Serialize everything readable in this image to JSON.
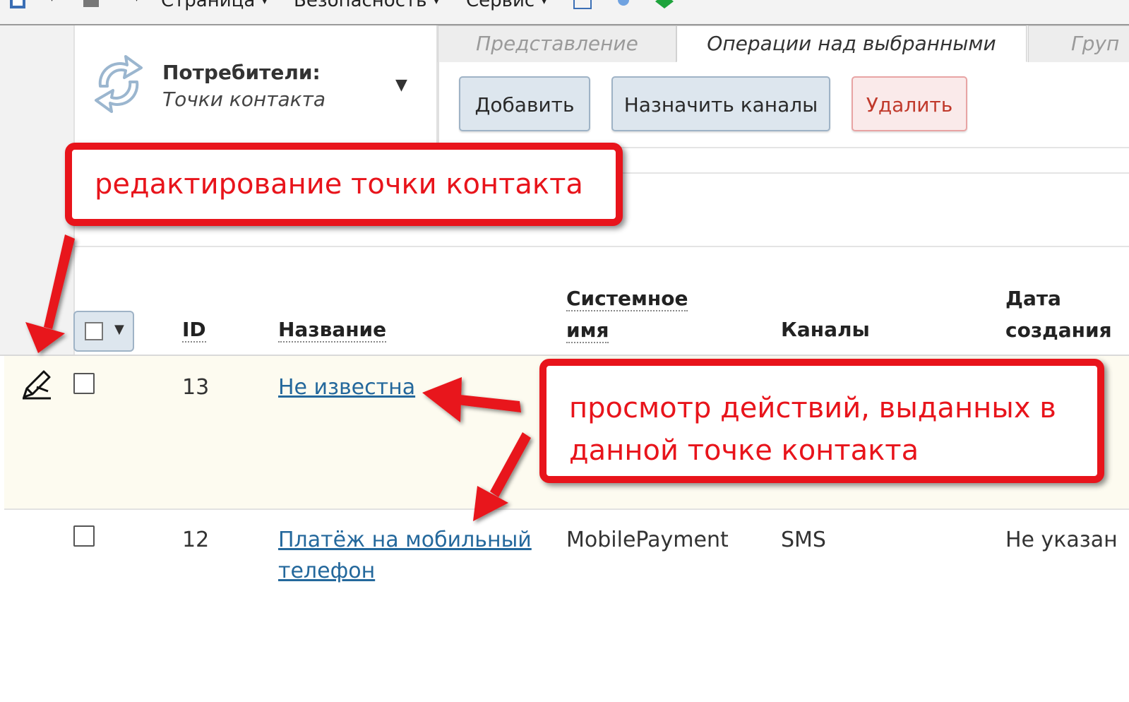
{
  "browser_menu": {
    "items": [
      "Страница",
      "Безопасность",
      "Сервис"
    ]
  },
  "module": {
    "title": "Потребители:",
    "subtitle": "Точки контакта",
    "icon": "arrows-cycle-icon"
  },
  "tabs": [
    {
      "label": "Представление",
      "active": false
    },
    {
      "label": "Операции над выбранными",
      "active": true
    },
    {
      "label": "Груп",
      "active": false
    }
  ],
  "toolbar": {
    "add_label": "Добавить",
    "assign_channels_label": "Назначить каналы",
    "delete_label": "Удалить"
  },
  "table": {
    "columns": {
      "id": "ID",
      "name": "Название",
      "system_name_1": "Системное",
      "system_name_2": "имя",
      "channels": "Каналы",
      "created_1": "Дата",
      "created_2": "создания"
    },
    "rows": [
      {
        "id": "13",
        "name": "Не известна",
        "system_name": "",
        "channels": "",
        "created": ""
      },
      {
        "id": "12",
        "name_line1": "Платёж на мобильный",
        "name_line2": "телефон",
        "system_name": "MobilePayment",
        "channels": "SMS",
        "created": "Не указан"
      }
    ]
  },
  "annotations": {
    "edit_note": "редактирование точки контакта",
    "view_note_line1": "просмотр действий, выданных в",
    "view_note_line2": "данной точке контакта",
    "color": "#e8141b"
  },
  "colors": {
    "link": "#24689c",
    "row_highlight": "#fdfbf0",
    "button_blue": "#dde6ee",
    "button_red": "#faeaea"
  }
}
